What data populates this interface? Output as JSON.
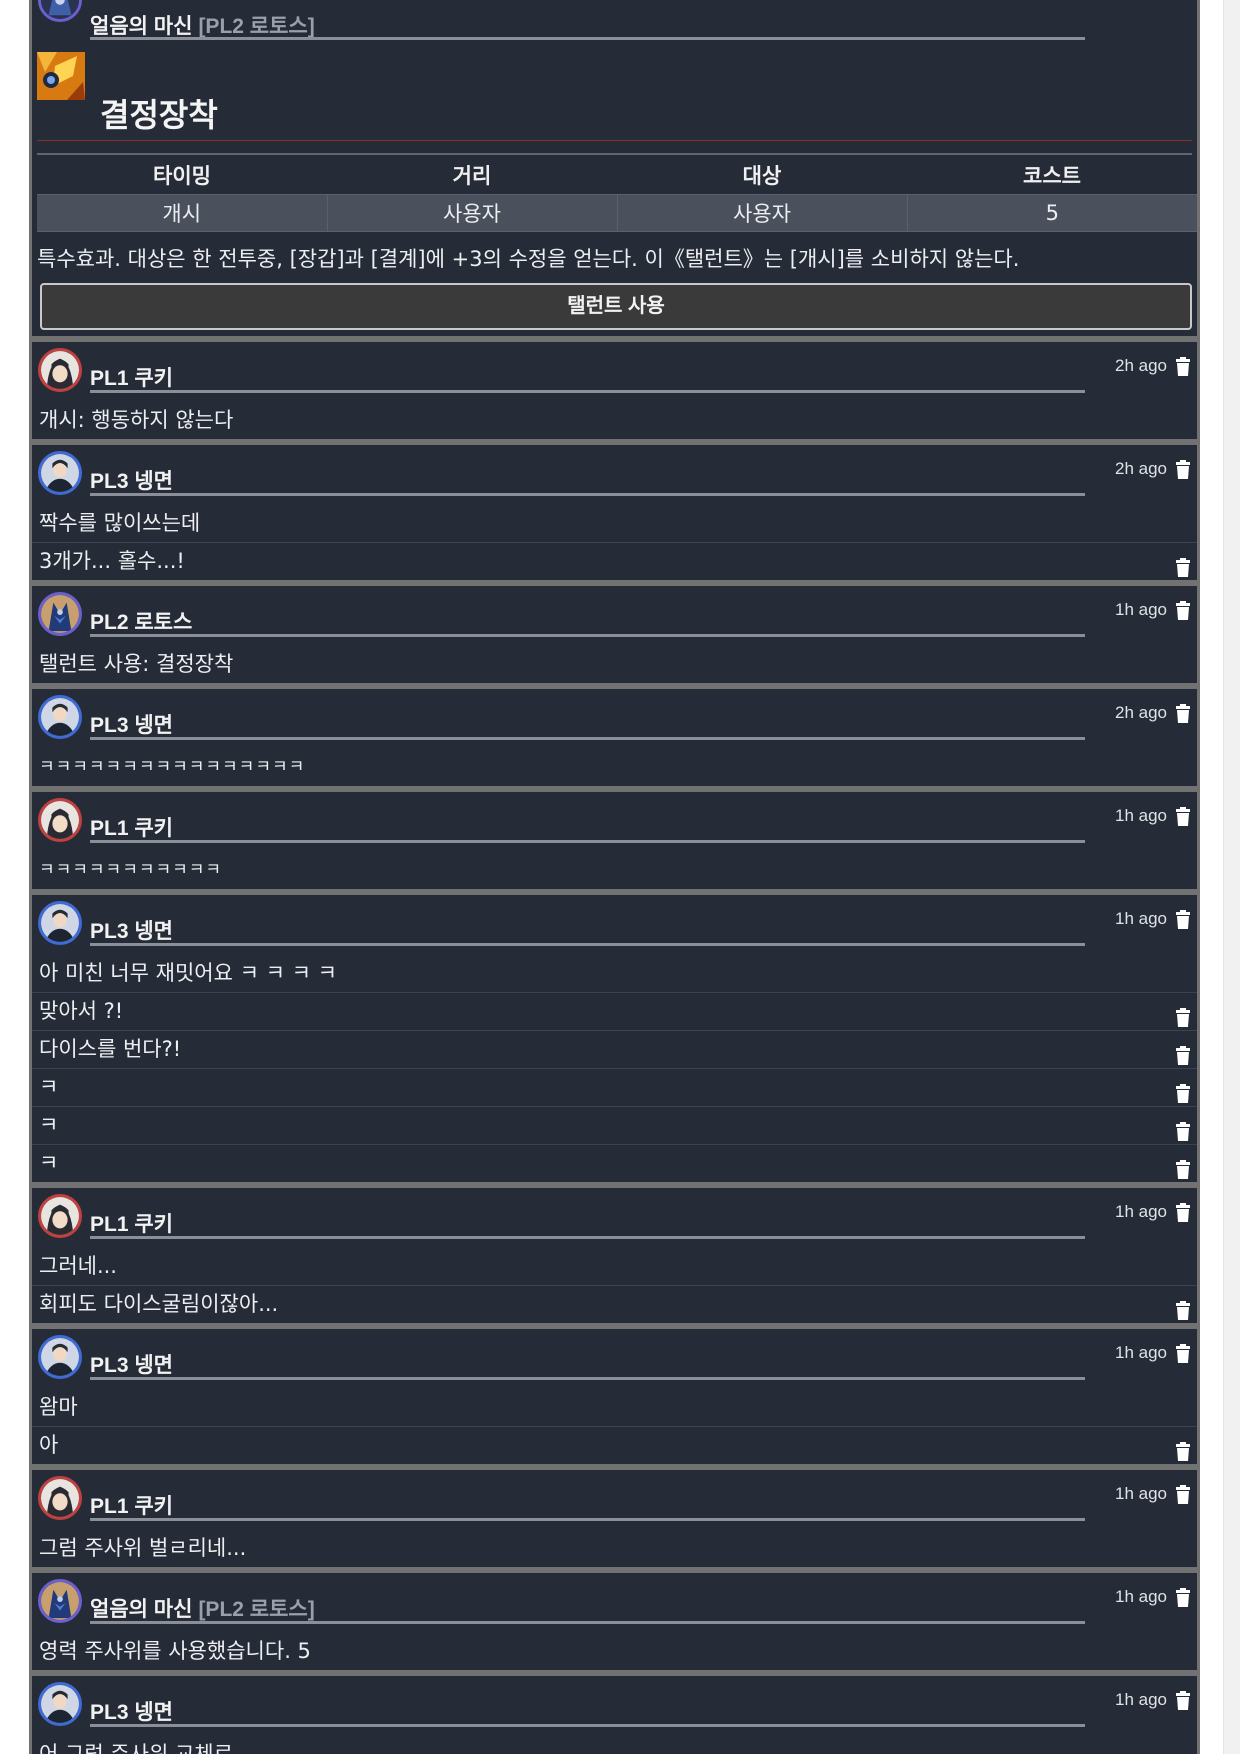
{
  "talent_card": {
    "speaker_name": "얼음의 마신",
    "speaker_sub": "[PL2 로토스]",
    "title": "결정장착",
    "table_headers": [
      "타이밍",
      "거리",
      "대상",
      "코스트"
    ],
    "table_values": [
      "개시",
      "사용자",
      "사용자",
      "5"
    ],
    "description": "특수효과. 대상은 한 전투중, [장갑]과 [결계]에 +3의 수정을 얻는다. 이《탤런트》는 [개시]를 소비하지 않는다.",
    "button_label": "탤런트 사용"
  },
  "messages": [
    {
      "name": "PL1 쿠키",
      "sub": "",
      "time": "2h ago",
      "avatar": "red",
      "lines": [
        "개시: 행동하지 않는다"
      ]
    },
    {
      "name": "PL3 넹면",
      "sub": "",
      "time": "2h ago",
      "avatar": "blue",
      "lines": [
        "짝수를 많이쓰는데",
        "3개가... 홀수...!"
      ]
    },
    {
      "name": "PL2 로토스",
      "sub": "",
      "time": "1h ago",
      "avatar": "purple",
      "lines": [
        "탤런트 사용: 결정장착"
      ]
    },
    {
      "name": "PL3 넹면",
      "sub": "",
      "time": "2h ago",
      "avatar": "blue",
      "lines": [
        "ㅋㅋㅋㅋㅋㅋㅋㅋㅋㅋㅋㅋㅋㅋㅋㅋ"
      ]
    },
    {
      "name": "PL1 쿠키",
      "sub": "",
      "time": "1h ago",
      "avatar": "red",
      "lines": [
        "ㅋㅋㅋㅋㅋㅋㅋㅋㅋㅋㅋ"
      ]
    },
    {
      "name": "PL3 넹면",
      "sub": "",
      "time": "1h ago",
      "avatar": "blue",
      "lines": [
        "아 미친 너무 재밋어요 ㅋ ㅋ ㅋ ㅋ",
        "맞아서 ?!",
        "다이스를 번다?!",
        "ㅋ",
        "ㅋ",
        "ㅋ"
      ]
    },
    {
      "name": "PL1 쿠키",
      "sub": "",
      "time": "1h ago",
      "avatar": "red",
      "lines": [
        "그러네...",
        "회피도 다이스굴림이잖아..."
      ]
    },
    {
      "name": "PL3 넹면",
      "sub": "",
      "time": "1h ago",
      "avatar": "blue",
      "lines": [
        "왐마",
        "아"
      ]
    },
    {
      "name": "PL1 쿠키",
      "sub": "",
      "time": "1h ago",
      "avatar": "red",
      "lines": [
        "그럼 주사위 벌ㄹ리네..."
      ]
    },
    {
      "name": "얼음의 마신",
      "sub": "[PL2 로토스]",
      "time": "1h ago",
      "avatar": "purple",
      "lines": [
        "영력 주사위를 사용했습니다. 5"
      ]
    },
    {
      "name": "PL3 넹면",
      "sub": "",
      "time": "1h ago",
      "avatar": "blue",
      "lines": [
        "어 그럼 주사위 교체로"
      ]
    }
  ],
  "icons": {
    "delete": "trash-icon",
    "talent": "talent-crystal-icon"
  }
}
